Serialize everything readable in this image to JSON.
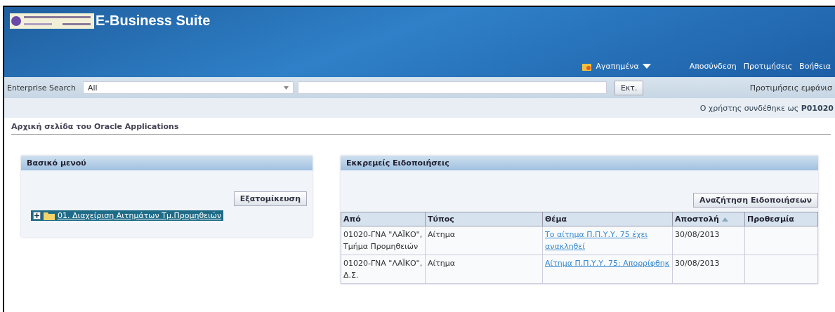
{
  "header": {
    "title": "E-Business Suite",
    "favorites": "Αγαπημένα",
    "links": [
      "Αποσύνδεση",
      "Προτιμήσεις",
      "Βοήθεια"
    ]
  },
  "search": {
    "label": "Enterprise Search",
    "scope": "All",
    "button": "Εκτ.",
    "preferences": "Προτιμήσεις εμφάνισ"
  },
  "user": {
    "text": "Ο χρήστης συνδέθηκε ως **P01020**"
  },
  "page_title": "Αρχική σελίδα του Oracle Applications",
  "main_menu": {
    "title": "Βασικό μενού",
    "button": "Εξατομίκευση",
    "items": [
      {
        "label": "01. Διαχείριση Αιτημάτων Τμ.Προμηθειών",
        "expanded": false,
        "selected": true
      }
    ]
  },
  "notifications": {
    "title": "Εκκρεμείς Ειδοποιήσεις",
    "button": "Αναζήτηση Ειδοποιήσεων",
    "columns": [
      {
        "label": "Από",
        "sorted": false
      },
      {
        "label": "Τύπος",
        "sorted": false
      },
      {
        "label": "Θέμα",
        "sorted": false
      },
      {
        "label": "Αποστολή",
        "sorted": true
      },
      {
        "label": "Προθεσμία",
        "sorted": false
      }
    ],
    "rows": [
      {
        "from": "01020-ΓΝΑ \"ΛΑΪΚΟ\", Τμήμα Προμηθειών",
        "type": "Αίτημα",
        "subject": "Το αίτημα Π.Π.Υ.Υ. 75 έχει ανακληθεί",
        "sent": "30/08/2013"
      },
      {
        "from": "01020-ΓΝΑ \"ΛΑΪΚΟ\", Δ.Σ.",
        "type": "Αίτημα",
        "subject": "Αίτημα Π.Π.Υ.Υ. 75: Απορρίφθηκ",
        "sent": "30/08/2013"
      }
    ]
  }
}
